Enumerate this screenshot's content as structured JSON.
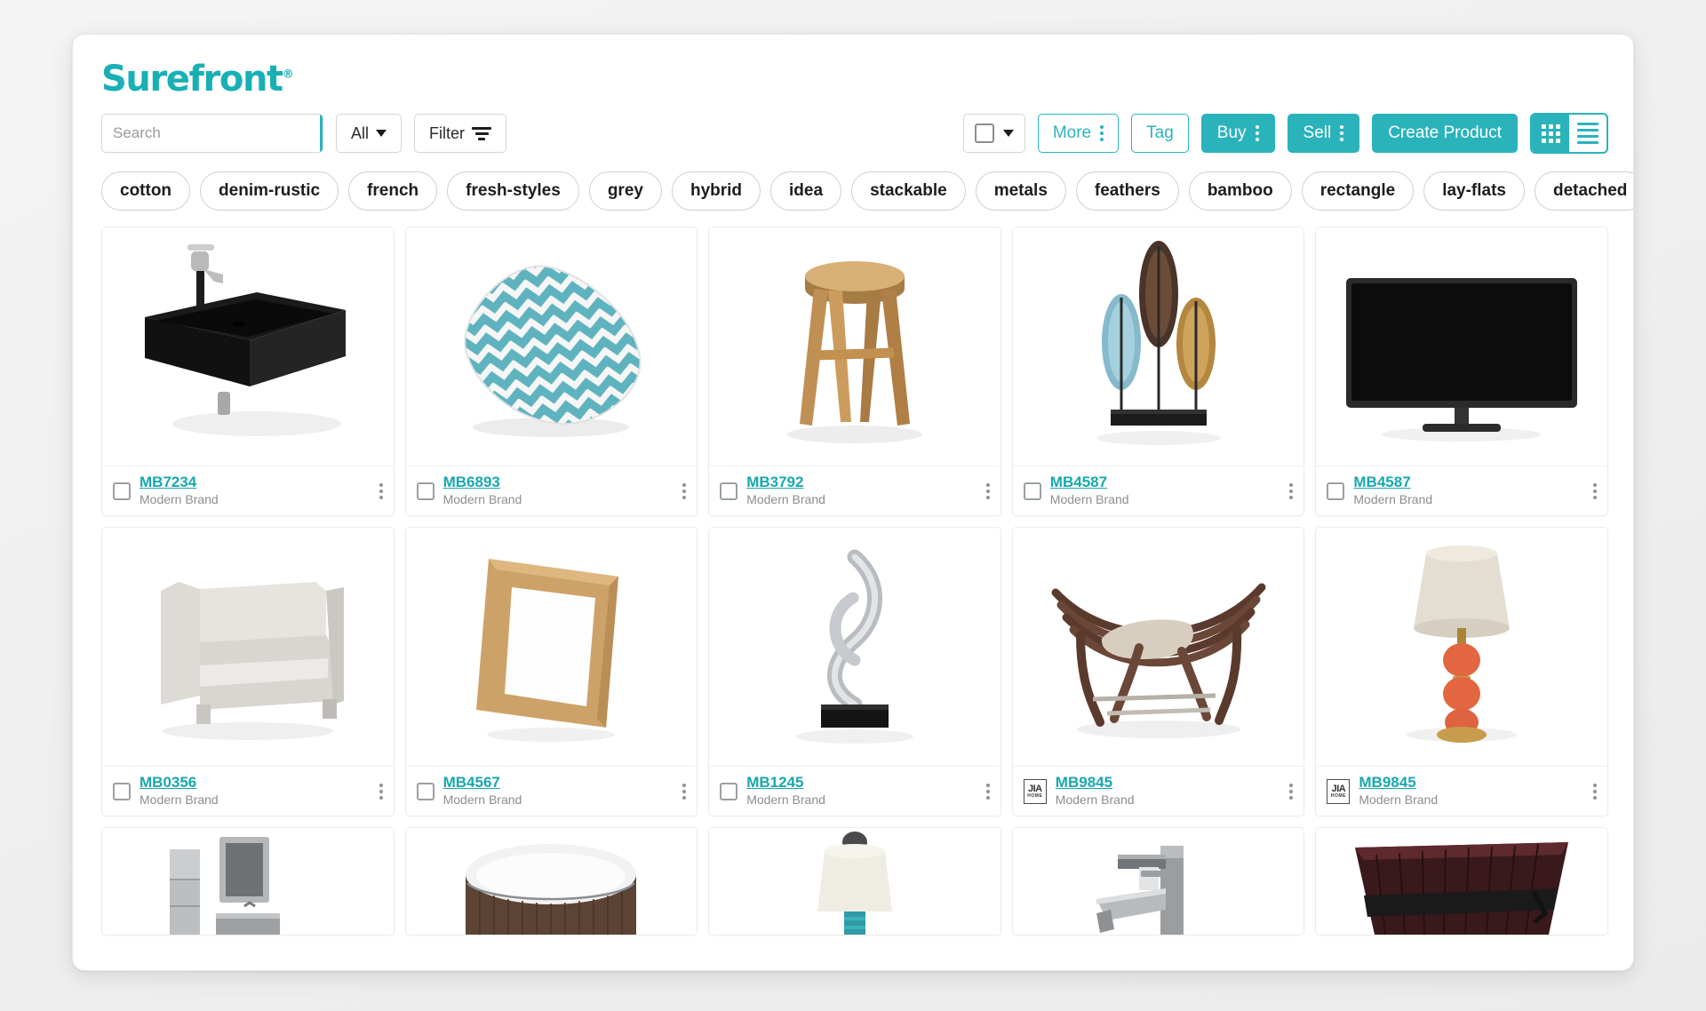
{
  "app": {
    "logo_text": "Surefront",
    "logo_mark": "®",
    "brand_color": "#2ab3bb",
    "link_color": "#17a8ae"
  },
  "search": {
    "placeholder": "Search",
    "value": "",
    "icon": "search-icon"
  },
  "toolbar": {
    "scope_label": "All",
    "scope_icon": "chevron-down-icon",
    "filter_label": "Filter",
    "filter_icon": "filter-lines-icon",
    "select_all_icon": "checkbox-icon",
    "select_all_chevron": "chevron-down-icon",
    "more_label": "More",
    "tag_label": "Tag",
    "buy_label": "Buy",
    "sell_label": "Sell",
    "create_product_label": "Create Product",
    "kebab_icon": "kebab-menu-icon",
    "view_grid_icon": "grid-view-icon",
    "view_list_icon": "list-view-icon",
    "active_view": "grid"
  },
  "tags": [
    "cotton",
    "denim-rustic",
    "french",
    "fresh-styles",
    "grey",
    "hybrid",
    "idea",
    "stackable",
    "metals",
    "feathers",
    "bamboo",
    "rectangle",
    "lay-flats",
    "detached"
  ],
  "products": {
    "row1": [
      {
        "sku": "MB7234",
        "brand": "Modern Brand",
        "mark": "checkbox",
        "image": "black-wall-sink"
      },
      {
        "sku": "MB6893",
        "brand": "Modern Brand",
        "mark": "checkbox",
        "image": "chevron-pillow"
      },
      {
        "sku": "MB3792",
        "brand": "Modern Brand",
        "mark": "checkbox",
        "image": "wood-stool"
      },
      {
        "sku": "MB4587",
        "brand": "Modern Brand",
        "mark": "checkbox",
        "image": "leaf-sculpture"
      },
      {
        "sku": "MB4587",
        "brand": "Modern Brand",
        "mark": "checkbox",
        "image": "flat-screen-tv"
      }
    ],
    "row2": [
      {
        "sku": "MB0356",
        "brand": "Modern Brand",
        "mark": "checkbox",
        "image": "grey-armchair"
      },
      {
        "sku": "MB4567",
        "brand": "Modern Brand",
        "mark": "checkbox",
        "image": "wood-picture-frame"
      },
      {
        "sku": "MB1245",
        "brand": "Modern Brand",
        "mark": "checkbox",
        "image": "silver-sculpture"
      },
      {
        "sku": "MB9845",
        "brand": "Modern Brand",
        "mark": "jia-home",
        "image": "curved-bench"
      },
      {
        "sku": "MB9845",
        "brand": "Modern Brand",
        "mark": "jia-home",
        "image": "coral-ball-lamp"
      }
    ],
    "row3": [
      {
        "image": "bathroom-vanity"
      },
      {
        "image": "wood-hot-tub"
      },
      {
        "image": "teal-table-lamp"
      },
      {
        "image": "chrome-faucet"
      },
      {
        "image": "dark-wood-tub"
      }
    ],
    "brandmark": {
      "line1": "JIA",
      "line2": "HOME"
    }
  }
}
